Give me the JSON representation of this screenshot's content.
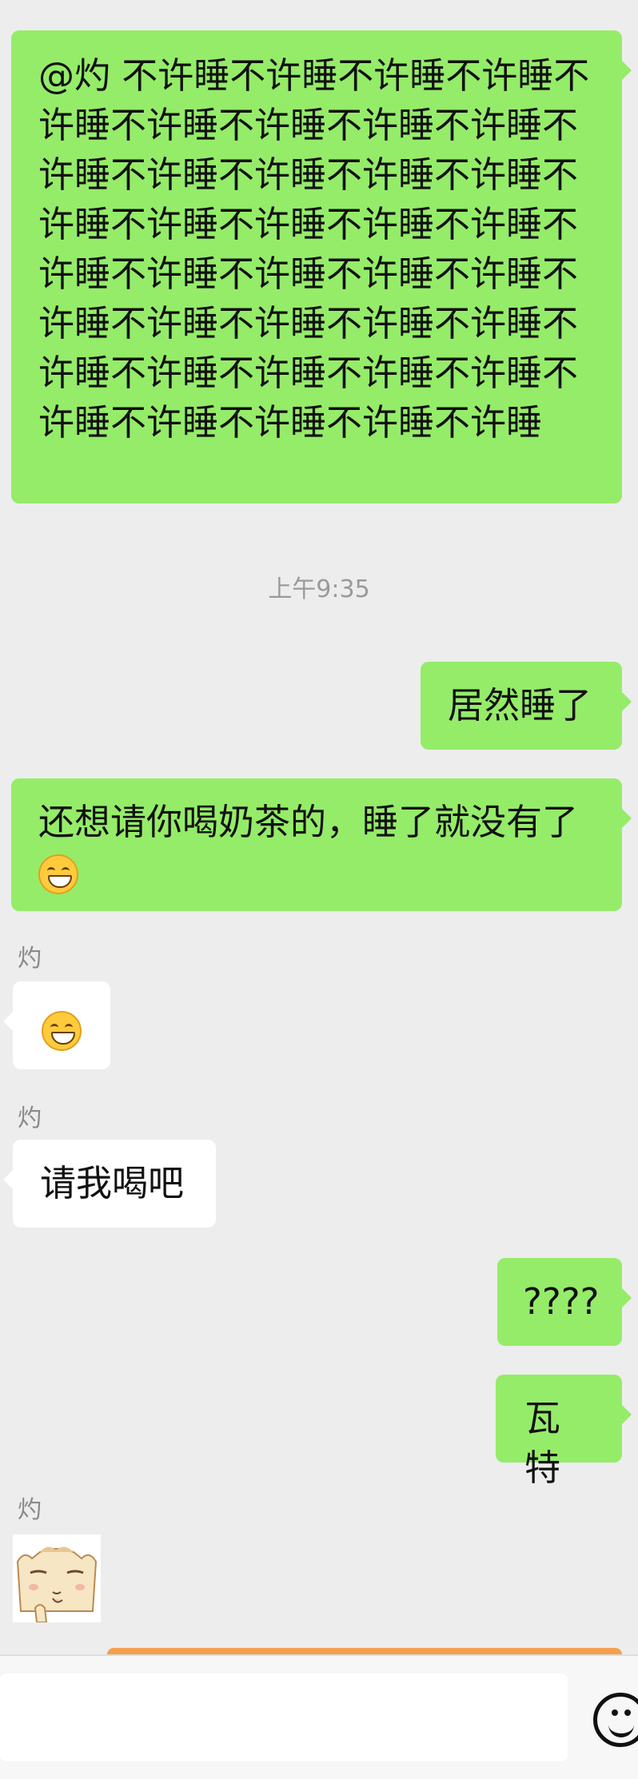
{
  "messages": [
    {
      "type": "text",
      "side": "mine",
      "text": "@灼  不许睡不许睡不许睡不许睡不许睡不许睡不许睡不许睡不许睡不许睡不许睡不许睡不许睡不许睡不许睡不许睡不许睡不许睡不许睡不许睡不许睡不许睡不许睡不许睡不许睡不许睡不许睡不许睡不许睡不许睡不许睡不许睡不许睡不许睡不许睡不许睡不许睡不许睡不许睡"
    },
    {
      "type": "timestamp",
      "text": "上午9:35"
    },
    {
      "type": "text",
      "side": "mine",
      "text": "居然睡了"
    },
    {
      "type": "text",
      "side": "mine",
      "text": "还想请你喝奶茶的，睡了就没有了",
      "emoji": "grin-emoji"
    },
    {
      "type": "sender",
      "text": "灼"
    },
    {
      "type": "emoji",
      "side": "theirs",
      "emoji": "grin-emoji"
    },
    {
      "type": "sender",
      "text": "灼"
    },
    {
      "type": "text",
      "side": "theirs",
      "text": "请我喝吧"
    },
    {
      "type": "text",
      "side": "mine",
      "text": "????"
    },
    {
      "type": "text",
      "side": "mine",
      "text": "瓦特"
    },
    {
      "type": "sender",
      "text": "灼"
    },
    {
      "type": "sticker",
      "side": "theirs",
      "icon": "cat-sticker-icon"
    }
  ],
  "input": {
    "value": ""
  },
  "colors": {
    "mine": "#95ec69",
    "theirs": "#ffffff",
    "background": "#ededed"
  }
}
